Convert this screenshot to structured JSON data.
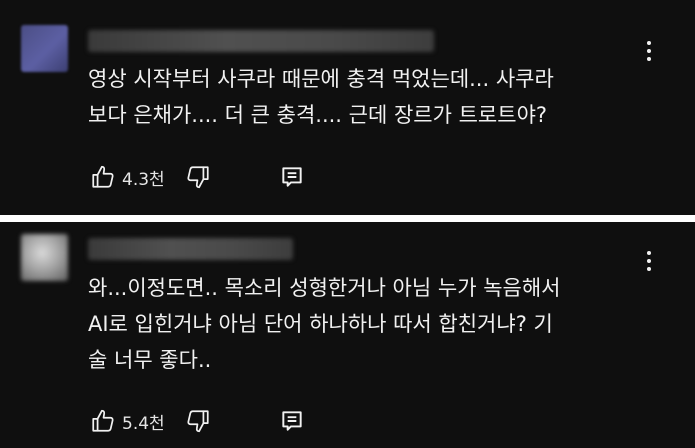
{
  "comments": [
    {
      "lines": [
        "영상 시작부터 사쿠라 때문에 충격 먹었는데... 사쿠라",
        "보다 은채가.... 더 큰 충격.... 근데 장르가 트로트야?"
      ],
      "likes": "4.3천"
    },
    {
      "lines": [
        "와...이정도면.. 목소리 성형한거나 아님 누가 녹음해서",
        "AI로 입힌거냐 아님 단어 하나하나 따서 합친거냐? 기",
        "술 너무 좋다.."
      ],
      "likes": "5.4천"
    }
  ],
  "icons": {
    "like": "thumb-up-icon",
    "dislike": "thumb-down-icon",
    "reply": "reply-icon",
    "menu": "more-vert-icon"
  }
}
